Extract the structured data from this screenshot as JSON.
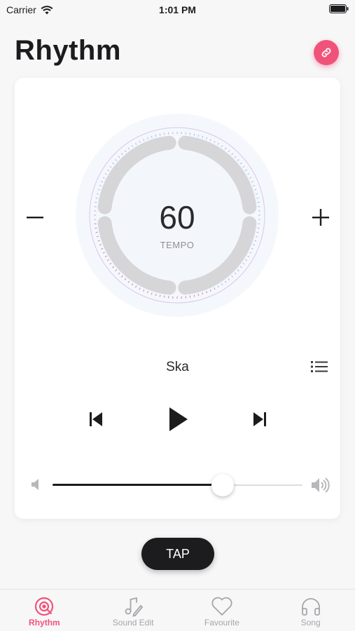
{
  "status_bar": {
    "carrier": "Carrier",
    "time": "1:01 PM"
  },
  "header": {
    "title": "Rhythm"
  },
  "tempo": {
    "value": "60",
    "label": "TEMPO"
  },
  "player": {
    "style_name": "Ska",
    "volume": 0.68
  },
  "tap_button": {
    "label": "TAP"
  },
  "colors": {
    "accent": "#f0537a",
    "dark": "#1c1c1e"
  },
  "tabs": [
    {
      "label": "Rhythm",
      "icon": "rhythm-icon",
      "active": true
    },
    {
      "label": "Sound Edit",
      "icon": "music-note-edit-icon",
      "active": false
    },
    {
      "label": "Favourite",
      "icon": "heart-icon",
      "active": false
    },
    {
      "label": "Song",
      "icon": "headphones-icon",
      "active": false
    }
  ]
}
